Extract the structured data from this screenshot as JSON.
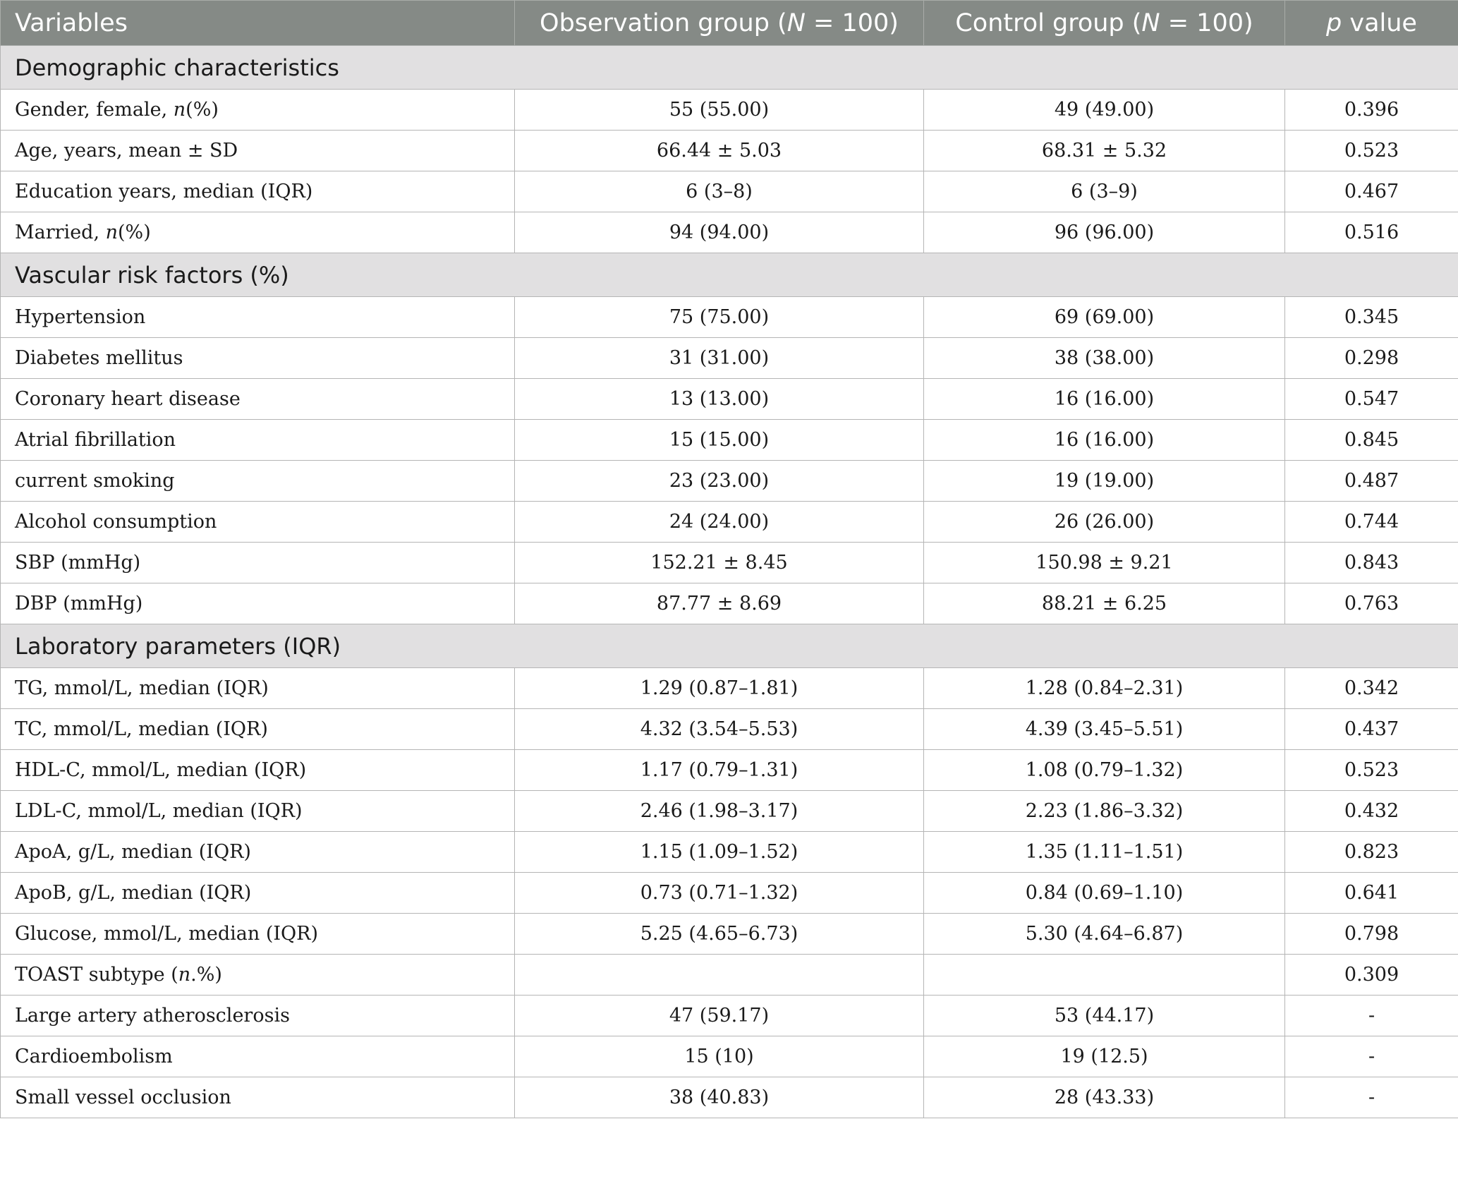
{
  "header": {
    "variables": "Variables",
    "observation_prefix": "Observation group (",
    "control_prefix": "Control group (",
    "n_letter": "N",
    "n_suffix": " = 100)",
    "p_letter": "p",
    "p_suffix": " value"
  },
  "sections": [
    {
      "title": "Demographic characteristics",
      "rows": [
        {
          "pre": "Gender, female, ",
          "it": "n",
          "post": "(%)",
          "obs": "55 (55.00)",
          "ctrl": "49 (49.00)",
          "p": "0.396"
        },
        {
          "pre": "Age, years, mean ± SD",
          "it": "",
          "post": "",
          "obs": "66.44 ± 5.03",
          "ctrl": "68.31 ± 5.32",
          "p": "0.523"
        },
        {
          "pre": "Education years, median (IQR)",
          "it": "",
          "post": "",
          "obs": "6 (3–8)",
          "ctrl": "6 (3–9)",
          "p": "0.467"
        },
        {
          "pre": "Married, ",
          "it": "n",
          "post": "(%)",
          "obs": "94 (94.00)",
          "ctrl": "96 (96.00)",
          "p": "0.516"
        }
      ]
    },
    {
      "title": "Vascular risk factors (%)",
      "rows": [
        {
          "pre": "Hypertension",
          "it": "",
          "post": "",
          "obs": "75 (75.00)",
          "ctrl": "69 (69.00)",
          "p": "0.345"
        },
        {
          "pre": "Diabetes mellitus",
          "it": "",
          "post": "",
          "obs": "31 (31.00)",
          "ctrl": "38 (38.00)",
          "p": "0.298"
        },
        {
          "pre": "Coronary heart disease",
          "it": "",
          "post": "",
          "obs": "13 (13.00)",
          "ctrl": "16 (16.00)",
          "p": "0.547"
        },
        {
          "pre": "Atrial fibrillation",
          "it": "",
          "post": "",
          "obs": "15 (15.00)",
          "ctrl": "16 (16.00)",
          "p": "0.845"
        },
        {
          "pre": "current smoking",
          "it": "",
          "post": "",
          "obs": "23 (23.00)",
          "ctrl": "19 (19.00)",
          "p": "0.487"
        },
        {
          "pre": "Alcohol consumption",
          "it": "",
          "post": "",
          "obs": "24 (24.00)",
          "ctrl": "26 (26.00)",
          "p": "0.744"
        },
        {
          "pre": "SBP (mmHg)",
          "it": "",
          "post": "",
          "obs": "152.21 ± 8.45",
          "ctrl": "150.98 ± 9.21",
          "p": "0.843"
        },
        {
          "pre": "DBP (mmHg)",
          "it": "",
          "post": "",
          "obs": "87.77 ± 8.69",
          "ctrl": "88.21 ± 6.25",
          "p": "0.763"
        }
      ]
    },
    {
      "title": "Laboratory parameters (IQR)",
      "rows": [
        {
          "pre": "TG, mmol/L, median (IQR)",
          "it": "",
          "post": "",
          "obs": "1.29 (0.87–1.81)",
          "ctrl": "1.28 (0.84–2.31)",
          "p": "0.342"
        },
        {
          "pre": "TC, mmol/L, median (IQR)",
          "it": "",
          "post": "",
          "obs": "4.32 (3.54–5.53)",
          "ctrl": "4.39 (3.45–5.51)",
          "p": "0.437"
        },
        {
          "pre": "HDL-C, mmol/L, median (IQR)",
          "it": "",
          "post": "",
          "obs": "1.17 (0.79–1.31)",
          "ctrl": "1.08 (0.79–1.32)",
          "p": "0.523"
        },
        {
          "pre": "LDL-C, mmol/L, median (IQR)",
          "it": "",
          "post": "",
          "obs": "2.46 (1.98–3.17)",
          "ctrl": "2.23 (1.86–3.32)",
          "p": "0.432"
        },
        {
          "pre": "ApoA, g/L, median (IQR)",
          "it": "",
          "post": "",
          "obs": "1.15 (1.09–1.52)",
          "ctrl": "1.35 (1.11–1.51)",
          "p": "0.823"
        },
        {
          "pre": "ApoB, g/L, median (IQR)",
          "it": "",
          "post": "",
          "obs": "0.73 (0.71–1.32)",
          "ctrl": "0.84 (0.69–1.10)",
          "p": "0.641"
        },
        {
          "pre": "Glucose, mmol/L, median (IQR)",
          "it": "",
          "post": "",
          "obs": "5.25 (4.65–6.73)",
          "ctrl": "5.30 (4.64–6.87)",
          "p": "0.798"
        },
        {
          "pre": "TOAST subtype (",
          "it": "n",
          "post": ".%)",
          "obs": "",
          "ctrl": "",
          "p": "0.309"
        },
        {
          "pre": "Large artery atherosclerosis",
          "it": "",
          "post": "",
          "obs": "47 (59.17)",
          "ctrl": "53 (44.17)",
          "p": "-"
        },
        {
          "pre": "Cardioembolism",
          "it": "",
          "post": "",
          "obs": "15 (10)",
          "ctrl": "19 (12.5)",
          "p": "-"
        },
        {
          "pre": "Small vessel occlusion",
          "it": "",
          "post": "",
          "obs": "38 (40.83)",
          "ctrl": "28 (43.33)",
          "p": "-"
        }
      ]
    }
  ]
}
